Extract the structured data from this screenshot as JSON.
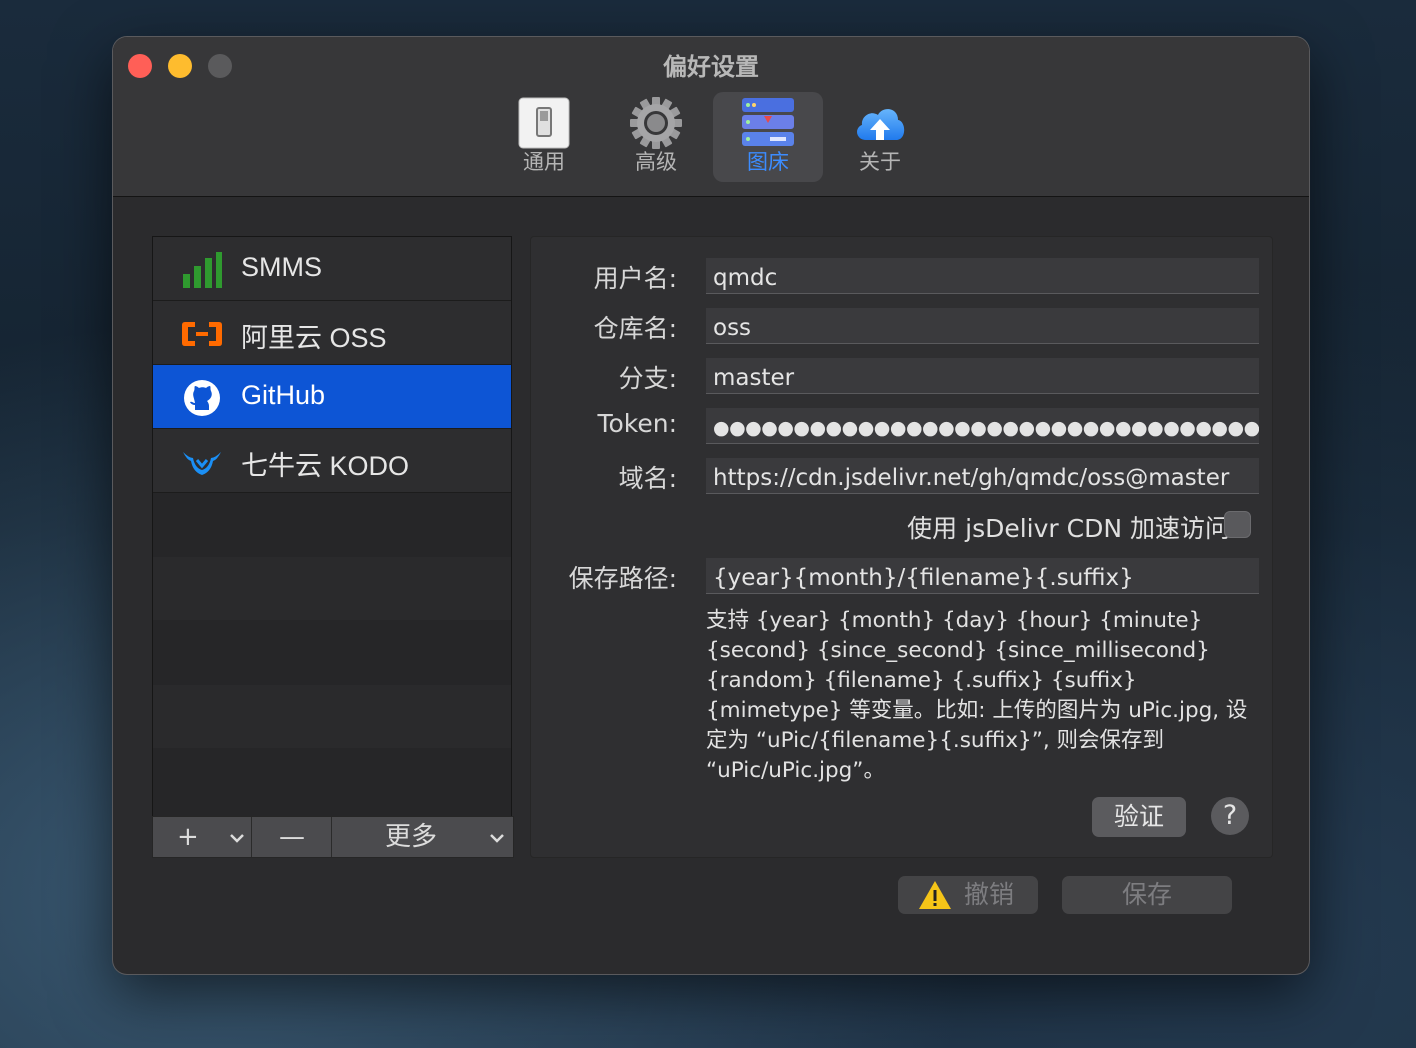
{
  "window": {
    "title": "偏好设置"
  },
  "toolbar": {
    "items": [
      {
        "label": "通用",
        "icon": "switch-icon"
      },
      {
        "label": "高级",
        "icon": "gear-icon"
      },
      {
        "label": "图床",
        "icon": "server-icon",
        "selected": true
      },
      {
        "label": "关于",
        "icon": "cloud-upload-icon"
      }
    ]
  },
  "sidebar": {
    "items": [
      {
        "label": "SMMS",
        "icon": "signal-bars-icon"
      },
      {
        "label": "阿里云 OSS",
        "icon": "aliyun-icon"
      },
      {
        "label": "GitHub",
        "icon": "github-icon",
        "selected": true
      },
      {
        "label": "七牛云 KODO",
        "icon": "qiniu-icon"
      }
    ],
    "add_label": "+",
    "remove_label": "—",
    "more_label": "更多"
  },
  "form": {
    "username_label": "用户名:",
    "username_value": "qmdc",
    "repo_label": "仓库名:",
    "repo_value": "oss",
    "branch_label": "分支:",
    "branch_value": "master",
    "token_label": "Token:",
    "token_value": "●●●●●●●●●●●●●●●●●●●●●●●●●●●●●●●●●●●●●…",
    "domain_label": "域名:",
    "domain_value": "https://cdn.jsdelivr.net/gh/qmdc/oss@master",
    "cdn_label": "使用 jsDelivr CDN 加速访问",
    "cdn_checked": false,
    "path_label": "保存路径:",
    "path_value": "{year}{month}/{filename}{.suffix}",
    "help_text": "支持 {year} {month} {day} {hour} {minute} {second} {since_second} {since_millisecond} {random} {filename} {.suffix} {suffix} {mimetype} 等变量。比如: 上传的图片为 uPic.jpg, 设定为 “uPic/{filename}{.suffix}”, 则会保存到 “uPic/uPic.jpg”。",
    "verify_label": "验证",
    "help_button_label": "?"
  },
  "actions": {
    "cancel_label": "撤销",
    "save_label": "保存"
  },
  "colors": {
    "selection_blue": "#0d55d5",
    "toolbar_selected_text": "#3c8cff"
  }
}
